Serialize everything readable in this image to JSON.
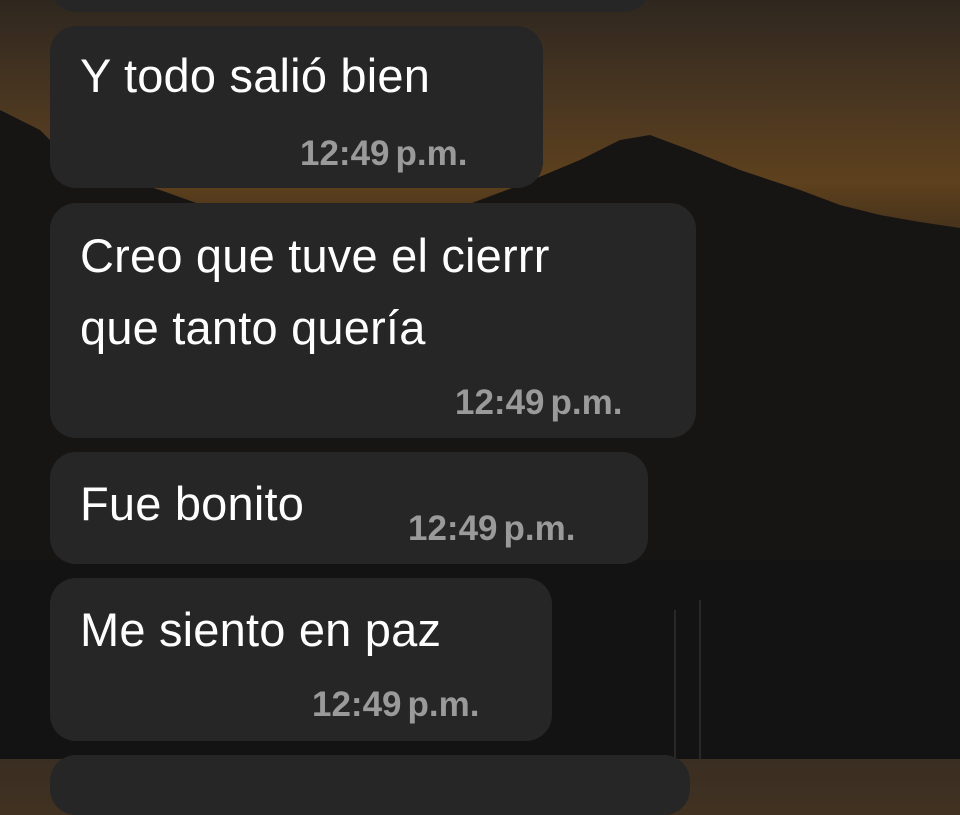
{
  "wallpaper": {
    "description_colors": {
      "sky_top": "#3a2e22",
      "sky_glow": "#5a3e1c",
      "mountain": "#141312"
    }
  },
  "chat": {
    "bubble_color": "#262626",
    "text_color": "#ffffff",
    "time_color": "#9a9a9a",
    "messages": [
      {
        "text_lines": [
          "Y todo salió bien"
        ],
        "time": "12:49",
        "ampm": "p.m."
      },
      {
        "text_lines": [
          "Creo que tuve el cierrr",
          "que tanto quería"
        ],
        "time": "12:49",
        "ampm": "p.m."
      },
      {
        "text_lines": [
          "Fue bonito"
        ],
        "time": "12:49",
        "ampm": "p.m."
      },
      {
        "text_lines": [
          "Me siento en paz"
        ],
        "time": "12:49",
        "ampm": "p.m."
      }
    ]
  }
}
